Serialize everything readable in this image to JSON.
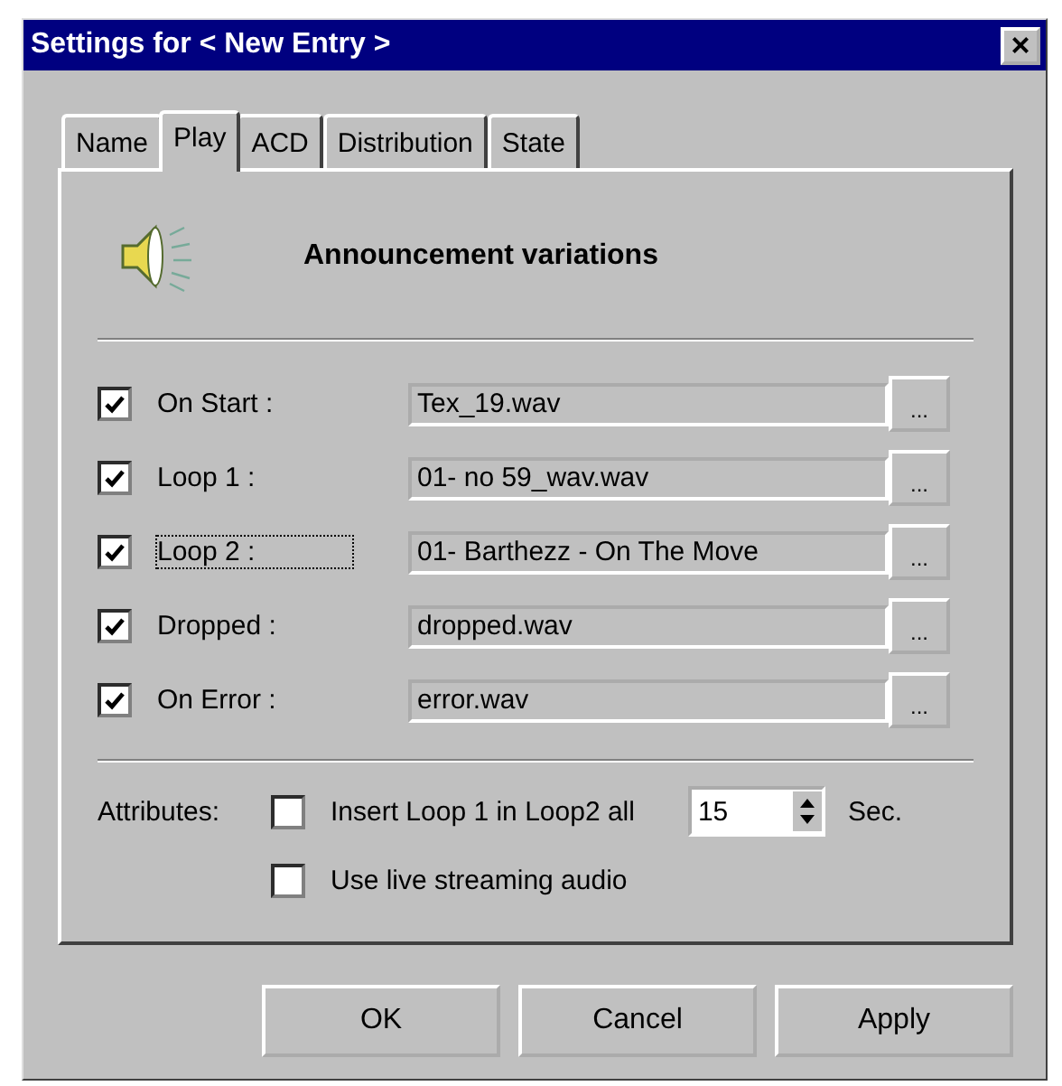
{
  "window": {
    "title": "Settings for < New Entry >",
    "close": "×"
  },
  "tabs": [
    {
      "label": "Name",
      "selected": false
    },
    {
      "label": "Play",
      "selected": true
    },
    {
      "label": "ACD",
      "selected": false
    },
    {
      "label": "Distribution",
      "selected": false
    },
    {
      "label": "State",
      "selected": false
    }
  ],
  "heading": "Announcement variations",
  "variations": [
    {
      "label": "On Start :",
      "checked": true,
      "focused": false,
      "file": "Tex_19.wav",
      "browse": "..."
    },
    {
      "label": "Loop 1 :",
      "checked": true,
      "focused": false,
      "file": "01- no 59_wav.wav",
      "browse": "..."
    },
    {
      "label": "Loop 2 :",
      "checked": true,
      "focused": true,
      "file": "01- Barthezz - On The Move",
      "browse": "..."
    },
    {
      "label": "Dropped  :",
      "checked": true,
      "focused": false,
      "file": "dropped.wav",
      "browse": "..."
    },
    {
      "label": "On Error :",
      "checked": true,
      "focused": false,
      "file": "error.wav",
      "browse": "..."
    }
  ],
  "attributes": {
    "label": "Attributes:",
    "insert_loop": {
      "label": "Insert Loop 1 in Loop2 all",
      "checked": false
    },
    "interval": "15",
    "unit": "Sec.",
    "live_streaming": {
      "label": "Use live streaming audio",
      "checked": false
    }
  },
  "buttons": [
    "OK",
    "Cancel",
    "Apply"
  ]
}
